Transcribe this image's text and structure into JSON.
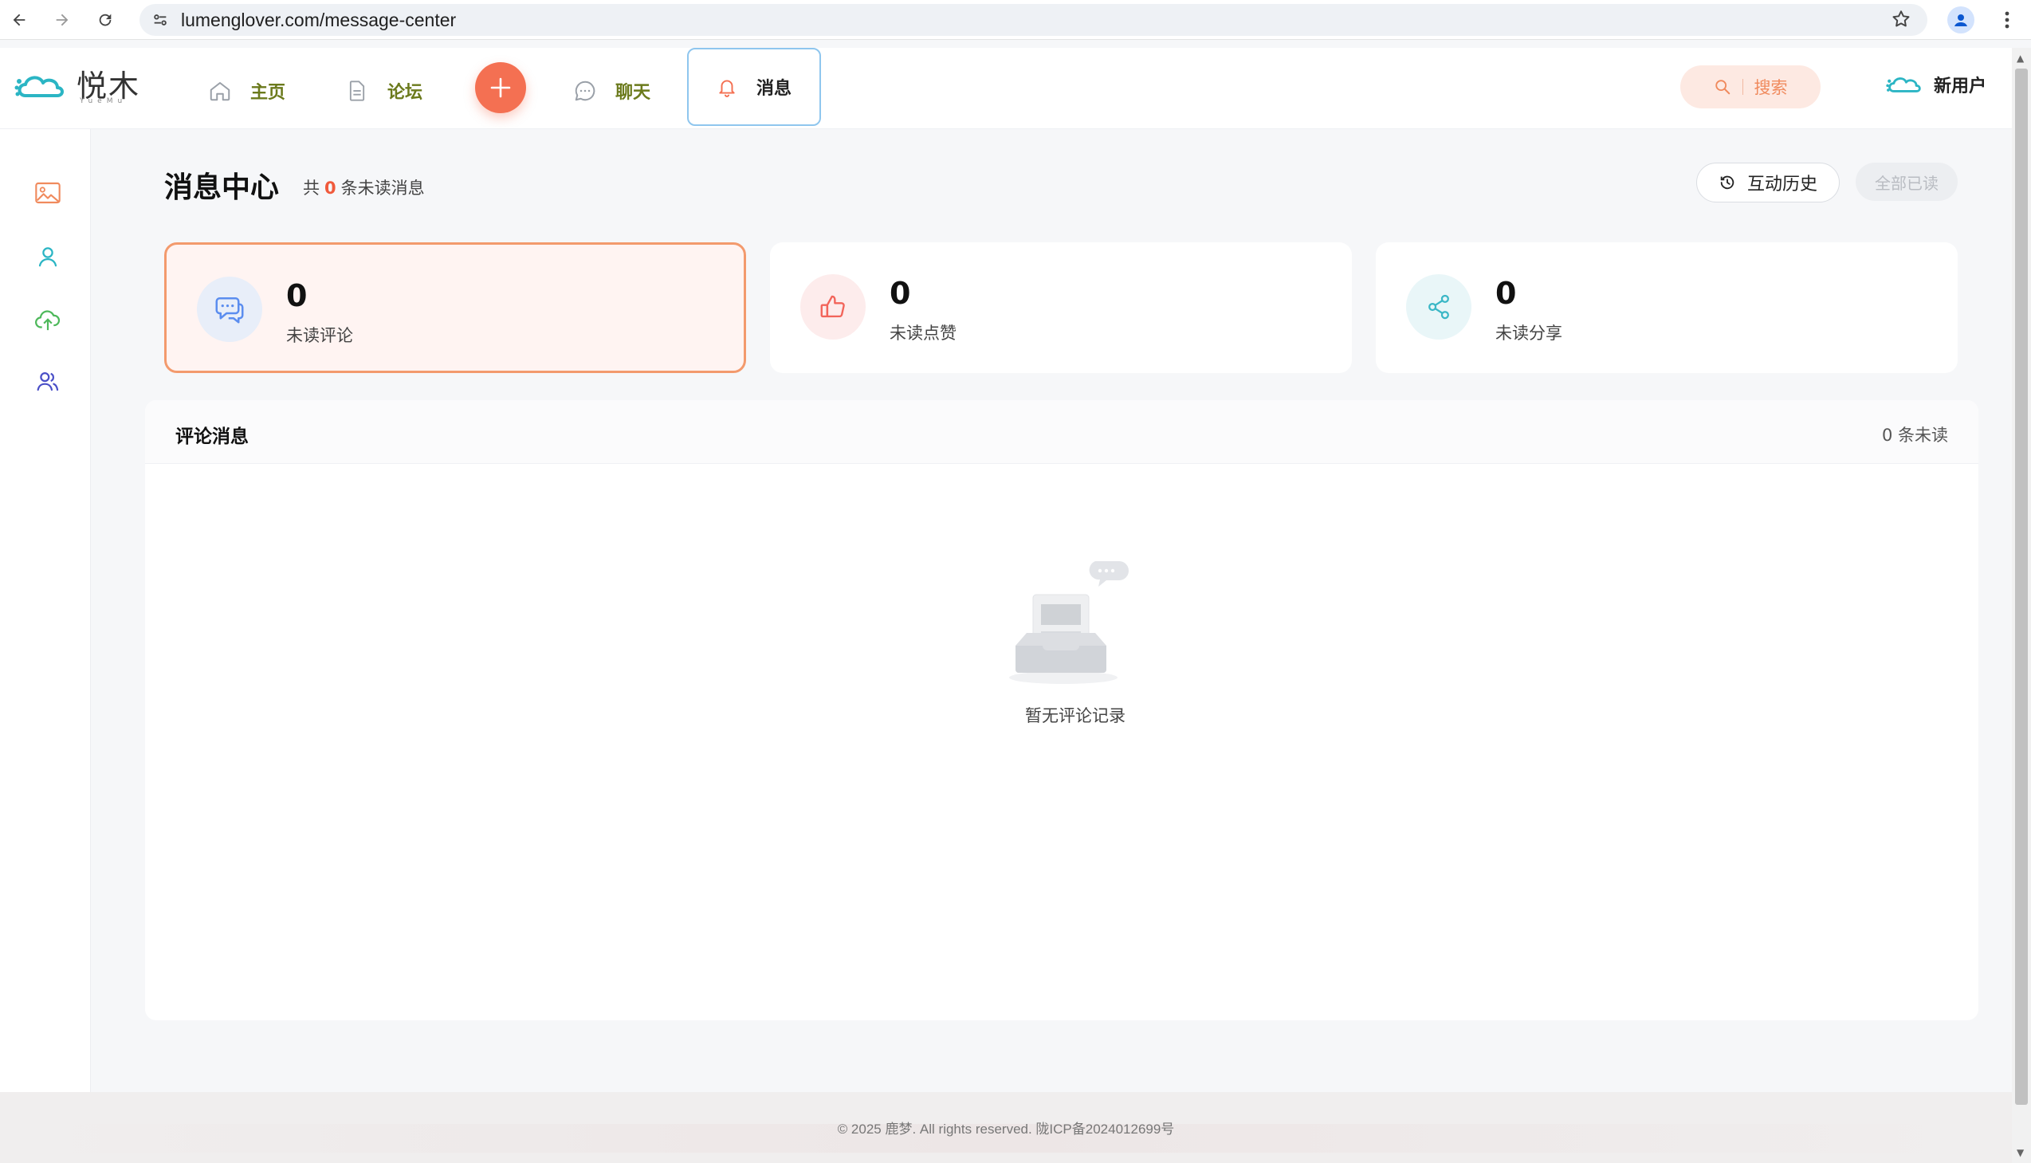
{
  "browser": {
    "url": "lumenglover.com/message-center"
  },
  "header": {
    "logo_text": "悦木",
    "logo_sub": "YueMu",
    "nav": {
      "home": "主页",
      "forum": "论坛",
      "chat": "聊天",
      "messages": "消息"
    },
    "search_label": "搜索",
    "user_name": "新用户"
  },
  "page": {
    "title": "消息中心",
    "count_prefix": "共",
    "unread_total": "0",
    "count_suffix": "条未读消息",
    "history_button": "互动历史",
    "read_all_button": "全部已读"
  },
  "stats": [
    {
      "value": "0",
      "label": "未读评论",
      "icon": "comment-icon",
      "color": "#5b8def"
    },
    {
      "value": "0",
      "label": "未读点赞",
      "icon": "thumbs-up-icon",
      "color": "#f2645a"
    },
    {
      "value": "0",
      "label": "未读分享",
      "icon": "share-icon",
      "color": "#3bb7c6"
    }
  ],
  "panel": {
    "title": "评论消息",
    "count": "0 条未读",
    "empty_text": "暂无评论记录"
  },
  "footer": {
    "text": "© 2025 鹿梦. All rights reserved. 陇ICP备2024012699号"
  },
  "colors": {
    "accent": "#f47052",
    "nav_text": "#6b7a1c",
    "active_border": "#8fc6ee",
    "active_card_border": "#f39a6d"
  }
}
